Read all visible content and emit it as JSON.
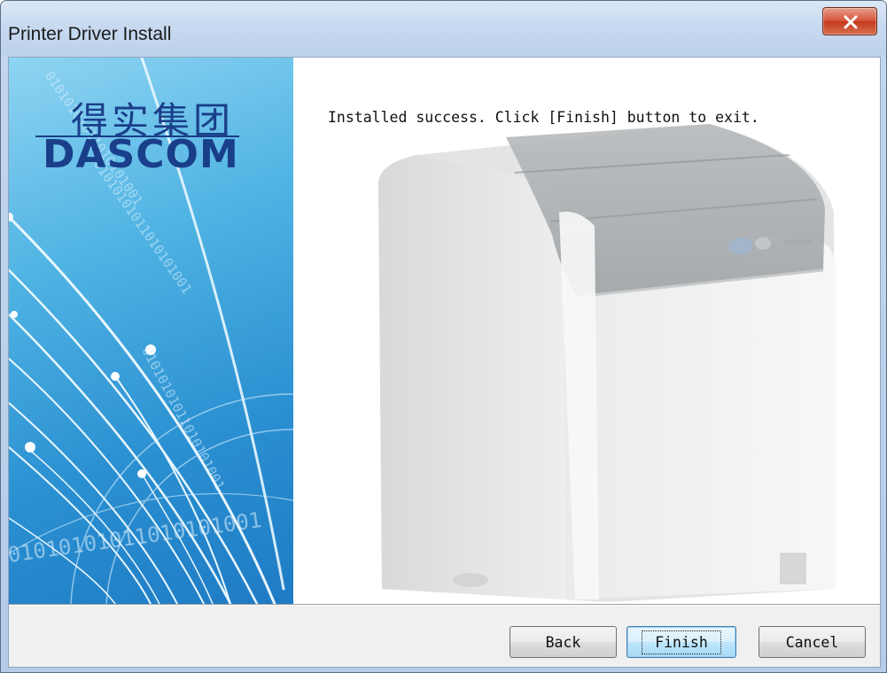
{
  "window": {
    "title": "Printer Driver Install"
  },
  "banner": {
    "logo_cn": "得实集团",
    "logo_en": "DASCOM",
    "binary_text": "01010101011010101001"
  },
  "content": {
    "message": "Installed success. Click [Finish] button to exit."
  },
  "buttons": {
    "back": "Back",
    "finish": "Finish",
    "cancel": "Cancel"
  },
  "colors": {
    "banner_blue": "#2a8fd1",
    "logo_blue": "#1a3f8a",
    "close_red": "#c43a1e"
  },
  "icons": {
    "close": "close-icon"
  }
}
